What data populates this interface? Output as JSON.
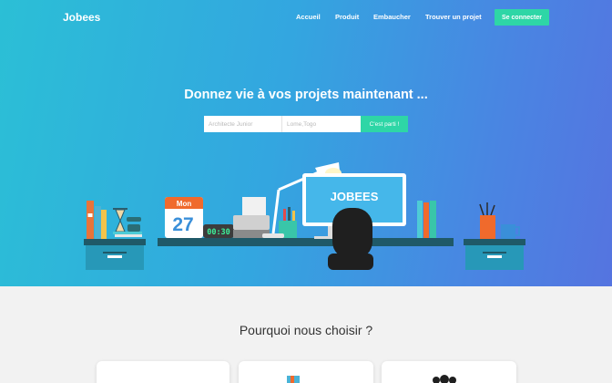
{
  "brand": "Jobees",
  "nav": {
    "home": "Accueil",
    "product": "Produit",
    "hire": "Embaucher",
    "find_project": "Trouver un projet",
    "login": "Se connecter"
  },
  "hero": {
    "headline": "Donnez vie à vos projets maintenant ...",
    "search": {
      "job_placeholder": "Architecte Junior",
      "location_placeholder": "Lome,Togo",
      "button": "C'est parti !"
    },
    "illustration": {
      "calendar_month": "Mon",
      "calendar_day": "27",
      "clock_time": "00:30",
      "monitor_logo": "JOBEES"
    }
  },
  "section": {
    "title": "Pourquoi nous choisir ?"
  },
  "colors": {
    "accent": "#2ed6a6",
    "hero_gradient_start": "#2bbfd6",
    "hero_gradient_end": "#5574e0"
  }
}
